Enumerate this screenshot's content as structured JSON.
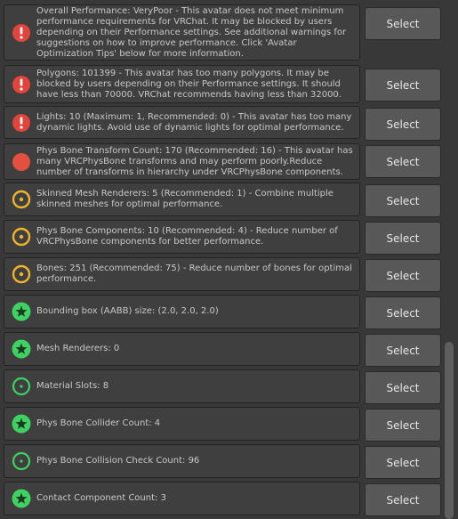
{
  "rows": [
    {
      "icon": "error-icon",
      "color": "#e0443b",
      "text": "Overall Performance: VeryPoor - This avatar does not meet minimum performance requirements for VRChat. It may be blocked by users depending on their Performance settings. See additional warnings for suggestions on how to improve performance. Click 'Avatar Optimization Tips' below for more information.",
      "button": "Select"
    },
    {
      "icon": "error-icon",
      "color": "#e0443b",
      "text": "Polygons: 101399 - This avatar has too many polygons. It may be blocked by users depending on their Performance settings. It should have less than 70000. VRChat recommends having less than 32000.",
      "button": "Select"
    },
    {
      "icon": "error-icon",
      "color": "#e0443b",
      "text": "Lights: 10 (Maximum: 1, Recommended: 0) - This avatar has too many dynamic lights. Avoid use of dynamic lights for optimal performance.",
      "button": "Select"
    },
    {
      "icon": "poor-icon",
      "color": "#e4503f",
      "text": "Phys Bone Transform Count: 170 (Recommended: 16) - This avatar has many VRCPhysBone transforms and may perform poorly.Reduce number of transforms in hierarchy under VRCPhysBone components.",
      "button": "Select"
    },
    {
      "icon": "medium-icon",
      "color": "#f0b429",
      "text": "Skinned Mesh Renderers: 5 (Recommended: 1) - Combine multiple skinned meshes for optimal performance.",
      "button": "Select"
    },
    {
      "icon": "medium-icon",
      "color": "#f0b429",
      "text": "Phys Bone Components: 10 (Recommended: 4) - Reduce number of VRCPhysBone components for better performance.",
      "button": "Select"
    },
    {
      "icon": "medium-icon",
      "color": "#f0b429",
      "text": "Bones: 251 (Recommended: 75) - Reduce number of bones for optimal performance.",
      "button": "Select"
    },
    {
      "icon": "star-icon",
      "color": "#3fd162",
      "text": "Bounding box (AABB) size: (2.0, 2.0, 2.0)",
      "button": "Select"
    },
    {
      "icon": "star-icon",
      "color": "#3fd162",
      "text": "Mesh Renderers: 0",
      "button": "Select"
    },
    {
      "icon": "dot-icon",
      "color": "#3fd162",
      "text": "Material Slots: 8",
      "button": "Select"
    },
    {
      "icon": "star-icon",
      "color": "#3fd162",
      "text": "Phys Bone Collider Count: 4",
      "button": "Select"
    },
    {
      "icon": "dot-icon",
      "color": "#3fd162",
      "text": "Phys Bone Collision Check Count: 96",
      "button": "Select"
    },
    {
      "icon": "star-icon",
      "color": "#3fd162",
      "text": "Contact Component Count: 3",
      "button": "Select"
    }
  ]
}
